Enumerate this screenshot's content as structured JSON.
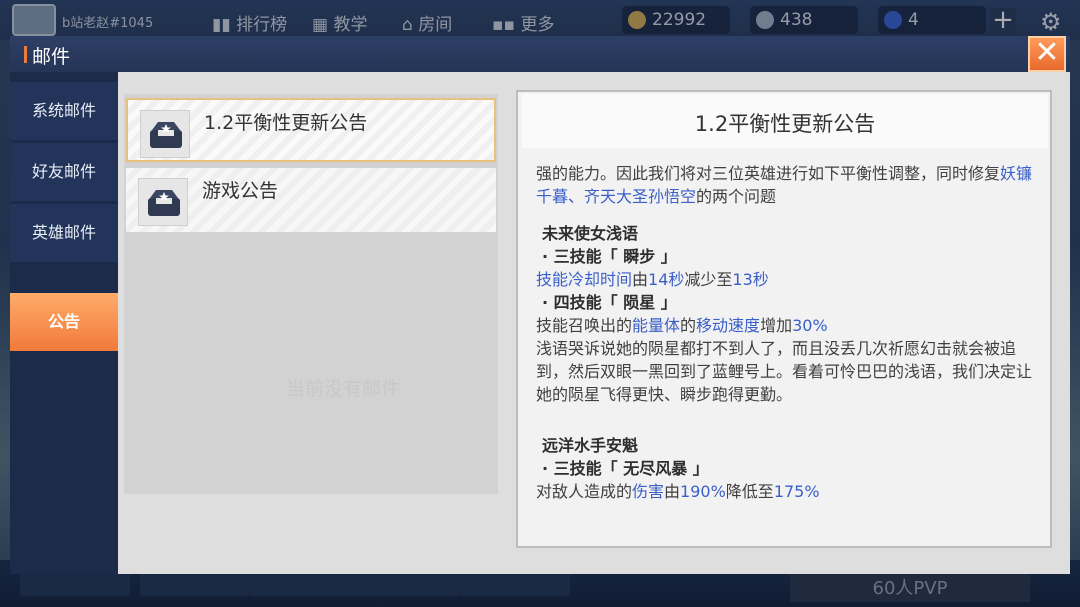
{
  "topbar": {
    "player_name": "b站老赵#1045",
    "nav": [
      "排行榜",
      "教学",
      "房间",
      "更多"
    ],
    "gold": "22992",
    "diamond": "438",
    "tickets": "4"
  },
  "bottombar": {
    "pvp_label": "60人PVP"
  },
  "dialog": {
    "title": "邮件",
    "close_label": "✕",
    "tabs": [
      "系统邮件",
      "好友邮件",
      "英雄邮件",
      "公告"
    ],
    "active_tab": "公告"
  },
  "mails": [
    {
      "title": "1.2平衡性更新公告",
      "icon": "mailbox-icon"
    },
    {
      "title": "游戏公告",
      "icon": "mailbox-icon"
    }
  ],
  "list_watermark": "当前没有邮件",
  "detail": {
    "title": "1.2平衡性更新公告",
    "intro_a": "强的能力。因此我们将对三位英雄进行如下平衡性调整，同时修复",
    "intro_hl": "妖镰千暮、齐天大圣孙悟空",
    "intro_b": "的两个问题",
    "hero1": "未来使女浅语",
    "hero1_skill3": "· 三技能「 瞬步 」",
    "hero1_s3_a": "技能冷却时间",
    "hero1_s3_b": "由",
    "hero1_s3_c": "14秒",
    "hero1_s3_d": "减少至",
    "hero1_s3_e": "13秒",
    "hero1_skill4": "· 四技能「 陨星 」",
    "hero1_s4_a": "技能召唤出的",
    "hero1_s4_b": "能量体",
    "hero1_s4_c": "的",
    "hero1_s4_d": "移动速度",
    "hero1_s4_e": "增加",
    "hero1_s4_f": "30%",
    "hero1_story": "浅语哭诉说她的陨星都打不到人了，而且没丢几次祈愿幻击就会被追到，然后双眼一黑回到了蓝鲤号上。看着可怜巴巴的浅语，我们决定让她的陨星飞得更快、瞬步跑得更勤。",
    "hero2": "远洋水手安魁",
    "hero2_skill3": "· 三技能「 无尽风暴 」",
    "hero2_s3_a": "对敌人造成的",
    "hero2_s3_b": "伤害",
    "hero2_s3_c": "由",
    "hero2_s3_d": "190%",
    "hero2_s3_e": "降低至",
    "hero2_s3_f": "175%"
  },
  "colors": {
    "accent": "#f07a3a",
    "highlight_text": "#3a5fc8",
    "header_bg": "#2d3f66"
  }
}
